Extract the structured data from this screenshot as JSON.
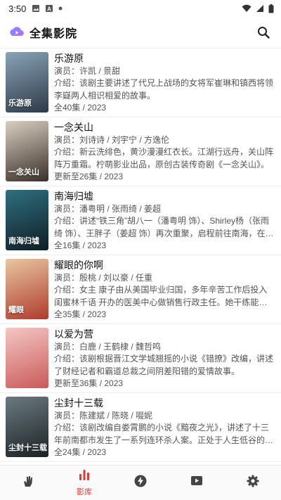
{
  "status_bar": {
    "time": "3:50"
  },
  "app": {
    "title": "全集影院"
  },
  "colors": {
    "accent": "#e53935",
    "icon_gray": "#444444"
  },
  "items": [
    {
      "title": "乐游原",
      "actors": "演员：许凯 / 景甜",
      "desc": "介绍：该剧主要讲述了代兄上战场的女将军崔琳和镇西将领李嶷两人相识相爱的故事。",
      "meta": "全40集 / 2023",
      "poster_text": "乐游原",
      "poster_colors": [
        "#8aa3b8",
        "#2d3a47"
      ]
    },
    {
      "title": "一念关山",
      "actors": "演员：刘诗诗 / 刘宇宁 / 方逸伦",
      "desc": "介绍：新云洗绯色，黄沙漫漫红衣长。江湖行远舟，关山阵阵万重霜。柠萌影业出品，原创古装传奇剧《一念关山》。",
      "meta": "更新至26集 / 2023",
      "poster_text": "一念关山",
      "poster_colors": [
        "#d9cfc0",
        "#3a2f2a"
      ]
    },
    {
      "title": "南海归墟",
      "actors": "演员：潘粤明 / 张雨绮 / 姜超",
      "desc": "介绍：讲述“铁三角”胡八一（潘粤明 饰）、Shirley杨（张雨绮 饰）、王胖子（姜超 饰）再次重聚，启程前往南海，在风暴中",
      "meta": "全16集 / 2023",
      "poster_text": "南海归墟",
      "poster_colors": [
        "#2f6f7f",
        "#0f1e26"
      ]
    },
    {
      "title": "耀眼的你啊",
      "actors": "演员：殷桃 / 刘以豪 / 任重",
      "desc": "介绍：女主 康子由从美国毕业归国，多年辛苦工作后投入闺蜜林千语 开办的医美中心做销售行政主任。她干练能干，年年都是",
      "meta": "全35集 / 2023",
      "poster_text": "耀眼",
      "poster_colors": [
        "#e8c7a0",
        "#b03a2e"
      ]
    },
    {
      "title": "以爱为营",
      "actors": "演员：白鹿 / 王鹤棣 / 魏哲鸣",
      "desc": "介绍：该剧根据晋江文学城翘摇的小说《错撩》改编，讲述了财经记者和霸道总裁之间阴差阳错的爱情故事。",
      "meta": "更新至36集 / 2023",
      "poster_text": "",
      "poster_colors": [
        "#f4c7c3",
        "#c95a5a"
      ]
    },
    {
      "title": "尘封十三载",
      "actors": "演员：陈建斌 / 陈晓 / 啜妮",
      "desc": "介绍：该剧改编自娄霄鹏的小说《黯夜之光》，讲述了十三年前南都市发生了一系列连环杀人案。正处于人生低谷的老刑警陆",
      "meta": "全24集 / 2023",
      "poster_text": "尘封十三载",
      "poster_colors": [
        "#6b7a80",
        "#1c2226"
      ]
    }
  ],
  "bottom_nav": {
    "tabs": [
      {
        "id": "home",
        "icon": "hand-icon",
        "label": ""
      },
      {
        "id": "library",
        "icon": "bars-icon",
        "label": "影库"
      },
      {
        "id": "live",
        "icon": "lightning-icon",
        "label": ""
      },
      {
        "id": "video",
        "icon": "play-icon",
        "label": ""
      },
      {
        "id": "settings",
        "icon": "gear-icon",
        "label": ""
      }
    ]
  }
}
